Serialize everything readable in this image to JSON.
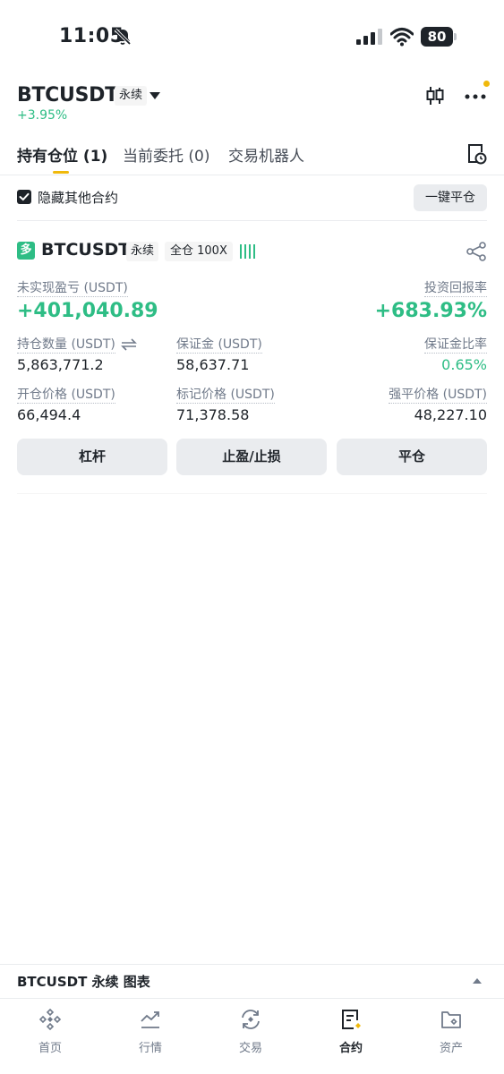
{
  "status_bar": {
    "time": "11:05",
    "battery": "80"
  },
  "header": {
    "symbol": "BTCUSDT",
    "contract_type": "永续",
    "change": "+3.95%"
  },
  "tabs": [
    {
      "label": "持有仓位 (1)",
      "active": true
    },
    {
      "label": "当前委托 (0)",
      "active": false
    },
    {
      "label": "交易机器人",
      "active": false
    }
  ],
  "filter": {
    "hide_others_label": "隐藏其他合约",
    "hide_others_checked": true,
    "close_all_label": "一键平仓"
  },
  "position": {
    "side_badge": "多",
    "symbol": "BTCUSDT",
    "contract_type": "永续",
    "margin_leverage": "全仓 100X",
    "unrealized_pnl_label": "未实现盈亏 (USDT)",
    "unrealized_pnl": "+401,040.89",
    "roe_label": "投资回报率",
    "roe": "+683.93%",
    "size_label": "持仓数量 (USDT)",
    "size": "5,863,771.2",
    "margin_label": "保证金 (USDT)",
    "margin": "58,637.71",
    "margin_ratio_label": "保证金比率",
    "margin_ratio": "0.65%",
    "entry_price_label": "开仓价格 (USDT)",
    "entry_price": "66,494.4",
    "mark_price_label": "标记价格 (USDT)",
    "mark_price": "71,378.58",
    "liq_price_label": "强平价格 (USDT)",
    "liq_price": "48,227.10",
    "buttons": {
      "leverage": "杠杆",
      "tp_sl": "止盈/止损",
      "close": "平仓"
    }
  },
  "chart_bar": {
    "label": "BTCUSDT 永续 图表"
  },
  "nav": [
    {
      "label": "首页",
      "icon": "home-icon",
      "active": false
    },
    {
      "label": "行情",
      "icon": "markets-icon",
      "active": false
    },
    {
      "label": "交易",
      "icon": "trade-icon",
      "active": false
    },
    {
      "label": "合约",
      "icon": "futures-icon",
      "active": true
    },
    {
      "label": "资产",
      "icon": "wallet-icon",
      "active": false
    }
  ],
  "colors": {
    "green": "#2ebd85",
    "yellow": "#f0b90b",
    "text": "#1e2329",
    "muted": "#707a8a"
  }
}
